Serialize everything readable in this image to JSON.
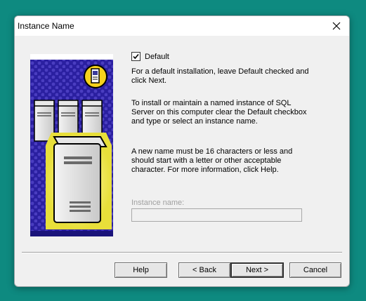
{
  "window": {
    "title": "Instance Name",
    "close_glyph": "✕"
  },
  "options": {
    "default_checked": true,
    "default_label": "Default"
  },
  "paragraphs": [
    "For a default installation, leave Default checked and click Next.",
    "To install or maintain a named instance of SQL Server on this computer clear the Default checkbox and type or select an instance name.",
    "A new name must be 16 characters or less and should start with a letter or other acceptable character.  For more information, click Help."
  ],
  "instance": {
    "label": "Instance name:",
    "value": ""
  },
  "buttons": {
    "help": "Help",
    "back": "< Back",
    "next": "Next >",
    "cancel": "Cancel"
  },
  "colors": {
    "desktop": "#0e8a80",
    "art_background": "#2a1fa0",
    "glow": "#f4ec5a"
  },
  "icons": [
    "close-icon",
    "checkmark-icon",
    "server-document-icon",
    "server-illustration"
  ]
}
